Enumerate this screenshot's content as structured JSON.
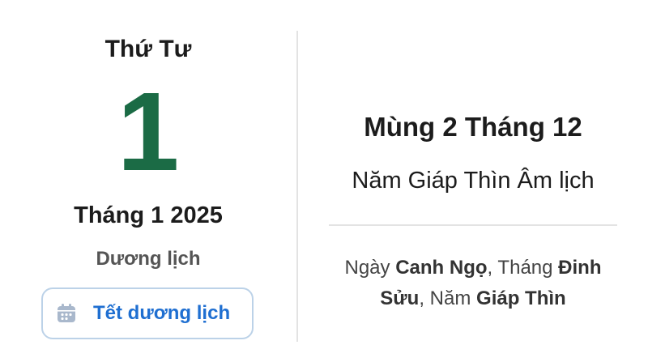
{
  "solar": {
    "weekday": "Thứ Tư",
    "day": "1",
    "month_year": "Tháng 1 2025",
    "calendar_type": "Dương lịch"
  },
  "holiday_button": {
    "label": "Tết dương lịch",
    "icon": "calendar-icon"
  },
  "lunar": {
    "date": "Mùng 2 Tháng 12",
    "year": "Năm Giáp Thìn Âm lịch",
    "ganzhi": {
      "day_prefix": "Ngày ",
      "day_value": "Canh Ngọ",
      "month_prefix": ", Tháng ",
      "month_value": "Đinh Sửu",
      "year_prefix": ", Năm ",
      "year_value": "Giáp Thìn"
    }
  },
  "colors": {
    "day_number": "#1b6b45",
    "button_text": "#1f6fd1",
    "button_border": "#bcd2e8",
    "divider": "#e3e3e3"
  }
}
